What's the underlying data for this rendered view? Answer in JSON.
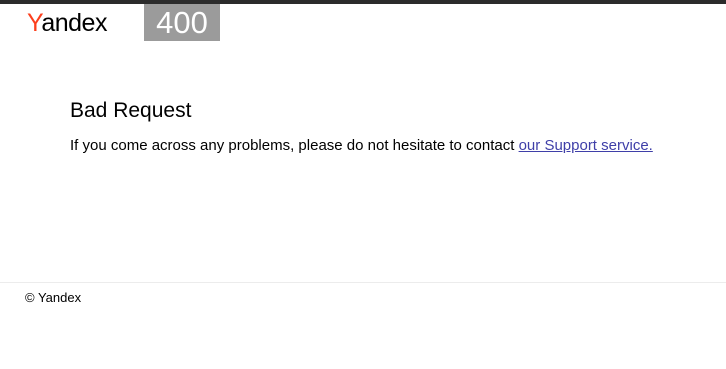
{
  "header": {
    "logo_first_letter": "Y",
    "logo_rest": "andex",
    "error_code": "400"
  },
  "main": {
    "title": "Bad Request",
    "message_prefix": "If you come across any problems, please do not hesitate to contact ",
    "support_link_label": "our Support service."
  },
  "footer": {
    "copyright": "© Yandex"
  },
  "colors": {
    "brand_accent": "#fc3f1d",
    "badge_background": "#9b9b9b",
    "link": "#3f3fa8",
    "top_bar": "#2b2b2b"
  }
}
